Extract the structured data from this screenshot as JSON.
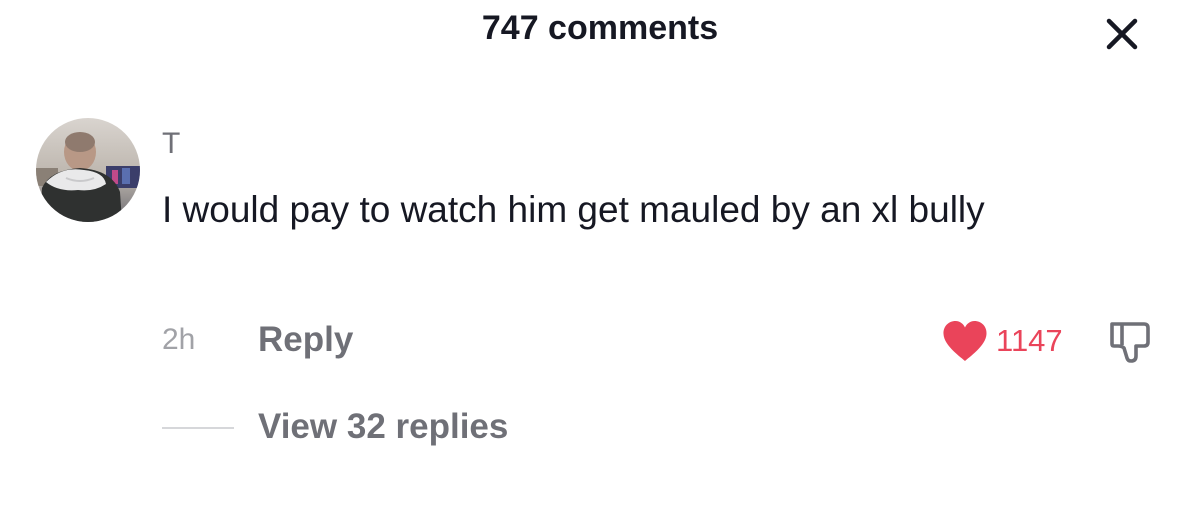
{
  "header": {
    "title": "747 comments",
    "close_icon": "close-icon"
  },
  "comment": {
    "avatar_icon": "user-avatar-photo",
    "username": "T",
    "text": "I would pay to watch him get mauled by an xl bully",
    "time": "2h",
    "reply_label": "Reply",
    "like_icon": "heart-icon",
    "like_count": "1147",
    "dislike_icon": "thumbs-down-icon",
    "view_replies_label": "View 32 replies"
  },
  "colors": {
    "like_accent": "#ea445a",
    "text_primary": "#161823",
    "text_secondary": "#6f7077",
    "text_tertiary": "#a1a2a7"
  }
}
